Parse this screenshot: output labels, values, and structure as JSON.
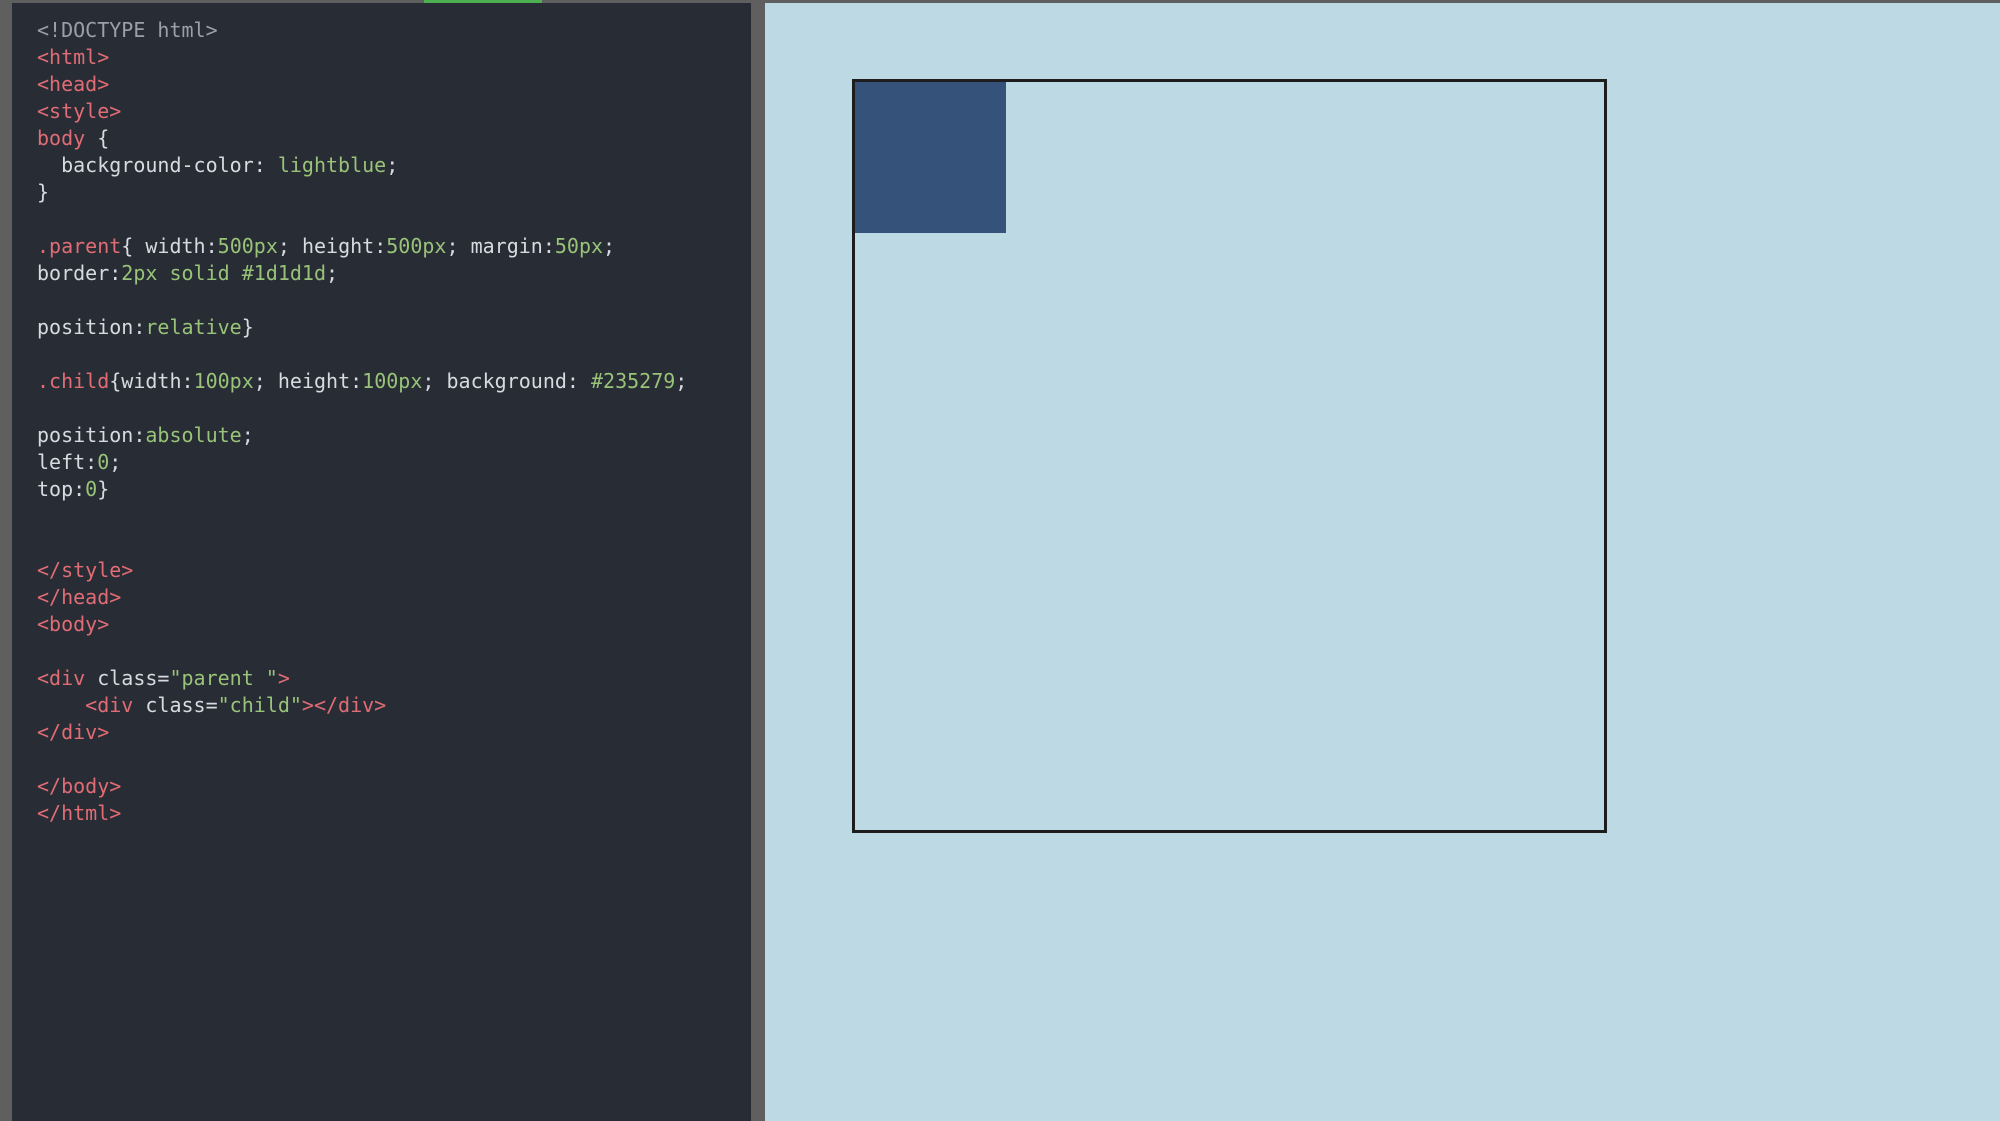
{
  "editor": {
    "lines": [
      [
        {
          "t": "<!DOCTYPE html>",
          "c": "doctype"
        }
      ],
      [
        {
          "t": "<html>",
          "c": "tag"
        }
      ],
      [
        {
          "t": "<head>",
          "c": "tag"
        }
      ],
      [
        {
          "t": "<style>",
          "c": "tag"
        }
      ],
      [
        {
          "t": "body",
          "c": "sel"
        },
        {
          "t": " {",
          "c": "punc"
        }
      ],
      [
        {
          "t": "  background-color",
          "c": "prop"
        },
        {
          "t": ": ",
          "c": "punc"
        },
        {
          "t": "lightblue",
          "c": "val"
        },
        {
          "t": ";",
          "c": "punc"
        }
      ],
      [
        {
          "t": "}",
          "c": "punc"
        }
      ],
      [],
      [
        {
          "t": ".parent",
          "c": "sel"
        },
        {
          "t": "{ ",
          "c": "punc"
        },
        {
          "t": "width",
          "c": "prop"
        },
        {
          "t": ":",
          "c": "punc"
        },
        {
          "t": "500px",
          "c": "val"
        },
        {
          "t": "; ",
          "c": "punc"
        },
        {
          "t": "height",
          "c": "prop"
        },
        {
          "t": ":",
          "c": "punc"
        },
        {
          "t": "500px",
          "c": "val"
        },
        {
          "t": "; ",
          "c": "punc"
        },
        {
          "t": "margin",
          "c": "prop"
        },
        {
          "t": ":",
          "c": "punc"
        },
        {
          "t": "50px",
          "c": "val"
        },
        {
          "t": ";",
          "c": "punc"
        }
      ],
      [
        {
          "t": "border",
          "c": "prop"
        },
        {
          "t": ":",
          "c": "punc"
        },
        {
          "t": "2px solid #1d1d1d",
          "c": "val"
        },
        {
          "t": ";",
          "c": "punc"
        }
      ],
      [],
      [
        {
          "t": "position",
          "c": "prop"
        },
        {
          "t": ":",
          "c": "punc"
        },
        {
          "t": "relative",
          "c": "val"
        },
        {
          "t": "}",
          "c": "punc"
        }
      ],
      [],
      [
        {
          "t": ".child",
          "c": "sel"
        },
        {
          "t": "{",
          "c": "punc"
        },
        {
          "t": "width",
          "c": "prop"
        },
        {
          "t": ":",
          "c": "punc"
        },
        {
          "t": "100px",
          "c": "val"
        },
        {
          "t": "; ",
          "c": "punc"
        },
        {
          "t": "height",
          "c": "prop"
        },
        {
          "t": ":",
          "c": "punc"
        },
        {
          "t": "100px",
          "c": "val"
        },
        {
          "t": "; ",
          "c": "punc"
        },
        {
          "t": "background",
          "c": "prop"
        },
        {
          "t": ": ",
          "c": "punc"
        },
        {
          "t": "#235279",
          "c": "val"
        },
        {
          "t": ";",
          "c": "punc"
        }
      ],
      [],
      [
        {
          "t": "position",
          "c": "prop"
        },
        {
          "t": ":",
          "c": "punc"
        },
        {
          "t": "absolute",
          "c": "val"
        },
        {
          "t": ";",
          "c": "punc"
        }
      ],
      [
        {
          "t": "left",
          "c": "prop"
        },
        {
          "t": ":",
          "c": "punc"
        },
        {
          "t": "0",
          "c": "val"
        },
        {
          "t": ";",
          "c": "punc"
        }
      ],
      [
        {
          "t": "top",
          "c": "prop"
        },
        {
          "t": ":",
          "c": "punc"
        },
        {
          "t": "0",
          "c": "val"
        },
        {
          "t": "}",
          "c": "punc"
        }
      ],
      [],
      [],
      [
        {
          "t": "</style>",
          "c": "tag"
        }
      ],
      [
        {
          "t": "</head>",
          "c": "tag"
        }
      ],
      [
        {
          "t": "<body>",
          "c": "tag"
        }
      ],
      [],
      [
        {
          "t": "<div ",
          "c": "tag"
        },
        {
          "t": "class=",
          "c": "attr"
        },
        {
          "t": "\"parent \"",
          "c": "str"
        },
        {
          "t": ">",
          "c": "tag"
        }
      ],
      [
        {
          "t": "    <div ",
          "c": "tag"
        },
        {
          "t": "class=",
          "c": "attr"
        },
        {
          "t": "\"child\"",
          "c": "str"
        },
        {
          "t": "></div>",
          "c": "tag"
        }
      ],
      [
        {
          "t": "</div>",
          "c": "tag"
        }
      ],
      [],
      [
        {
          "t": "</body>",
          "c": "tag"
        }
      ],
      [
        {
          "t": "</html>",
          "c": "tag"
        }
      ]
    ]
  },
  "preview": {
    "background_color": "#bcd9e4",
    "parent_border_color": "#1d1d1d",
    "child_color": "#34527a"
  },
  "colors": {
    "editor_bg": "#282c34",
    "active_tab_indicator": "#4caf50"
  }
}
